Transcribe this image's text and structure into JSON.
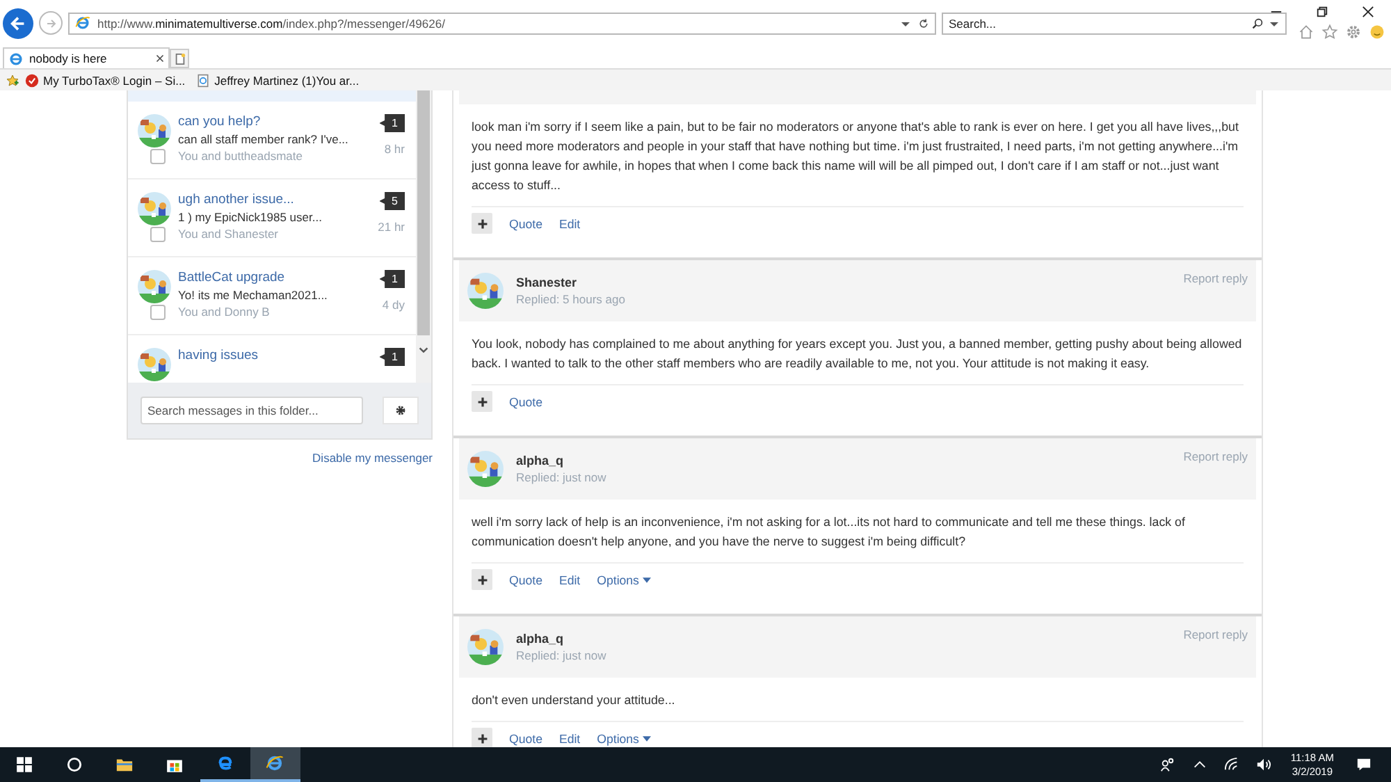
{
  "browser": {
    "address": "http://www.**minimatemultiverse.com**/index.php?/messenger/49626/",
    "search_placeholder": "Search...",
    "tabs": [
      {
        "title": "nobody is here",
        "selected": true
      }
    ],
    "favorites": [
      "My TurboTax® Login – Si...",
      "Jeffrey Martinez (1)You ar..."
    ]
  },
  "conversations": [
    {
      "title": "can you help?",
      "preview": "can all staff member rank? I've...",
      "participants": "You and buttheadsmate",
      "count": "1",
      "time": "8 hr",
      "checked": false
    },
    {
      "title": "ugh another issue...",
      "preview": "1 ) my EpicNick1985 user...",
      "participants": "You and Shanester",
      "count": "5",
      "time": "21 hr",
      "checked": false
    },
    {
      "title": "BattleCat upgrade",
      "preview": "Yo! its me Mechaman2021...",
      "participants": "You and Donny B",
      "count": "1",
      "time": "4 dy",
      "checked": false
    },
    {
      "title": "having issues",
      "count": "1"
    }
  ],
  "folder_search": {
    "placeholder": "Search messages in this folder..."
  },
  "disable_link": "Disable my messenger",
  "posts": [
    {
      "body": "look man i'm sorry if I seem like a pain, but to be fair no moderators or anyone that's able to rank is ever on here. I get you all have lives,,,but you need more moderators and people in your staff that have nothing but time. i'm just frustraited, I need parts, i'm not getting anywhere...i'm just gonna leave for awhile, in hopes that when I come back this name will will be all pimped out, I don't care if I am staff or not...just want access to stuff...",
      "actions": [
        {
          "kind": "link",
          "label": "Quote"
        },
        {
          "kind": "link",
          "label": "Edit"
        }
      ]
    },
    {
      "author": "Shanester",
      "replied": "Replied: 5 hours ago",
      "report": "Report reply",
      "body": "You look, nobody has complained to me about anything for years except you. Just you, a banned member, getting pushy about being allowed back.  I wanted to talk to the other staff members who are readily available to me, not you.  Your attitude is not making it easy.",
      "actions": [
        {
          "kind": "link",
          "label": "Quote"
        }
      ]
    },
    {
      "author": "alpha_q",
      "replied": "Replied: just now",
      "report": "Report reply",
      "body": "well i'm sorry lack of help is an inconvenience, i'm not asking for a lot...its not hard to communicate and tell me these things. lack of communication doesn't help anyone, and you have the nerve to suggest i'm being difficult?",
      "actions": [
        {
          "kind": "link",
          "label": "Quote"
        },
        {
          "kind": "link",
          "label": "Edit"
        },
        {
          "kind": "menu",
          "label": "Options"
        }
      ]
    },
    {
      "author": "alpha_q",
      "replied": "Replied: just now",
      "report": "Report reply",
      "body": "don't even understand your attitude...",
      "actions": [
        {
          "kind": "link",
          "label": "Quote"
        },
        {
          "kind": "link",
          "label": "Edit"
        },
        {
          "kind": "menu",
          "label": "Options"
        }
      ]
    }
  ],
  "taskbar": {
    "time": "11:18 AM",
    "date": "3/2/2019"
  }
}
